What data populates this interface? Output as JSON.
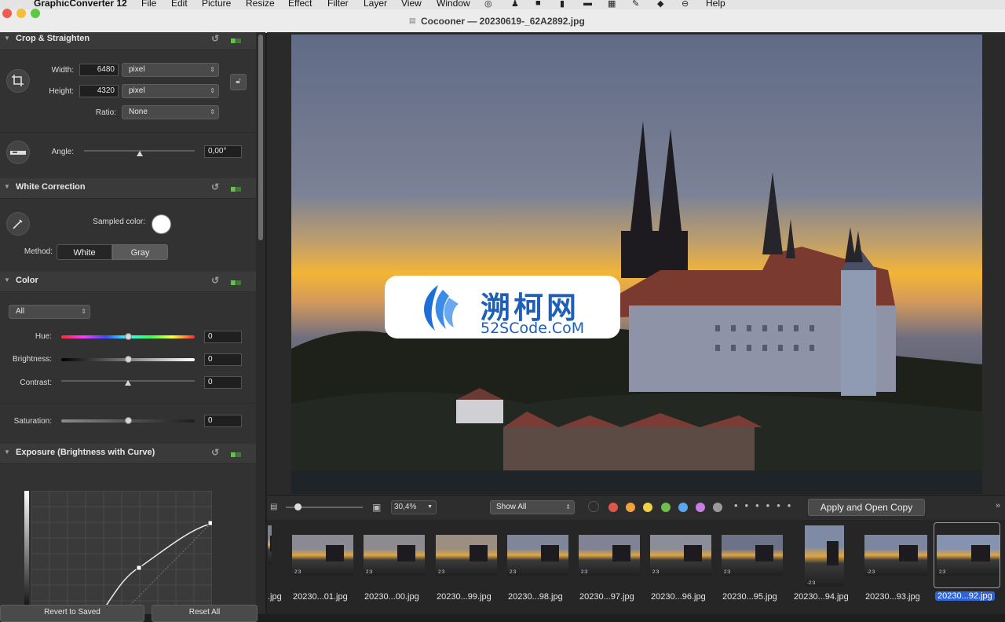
{
  "menubar": {
    "app_name": "GraphicConverter 12",
    "items": [
      "File",
      "Edit",
      "Picture",
      "Resize",
      "Effect",
      "Filter",
      "Layer",
      "View",
      "Window",
      "Help"
    ],
    "icons": [
      "target-icon",
      "person-icon",
      "camera-icon",
      "document-icon",
      "folder-icon",
      "grid-icon",
      "brush-icon",
      "tag-icon",
      "more-icon"
    ]
  },
  "window": {
    "title": "Cocooner — 20230619-_62A2892.jpg"
  },
  "crop": {
    "title": "Crop & Straighten",
    "width_label": "Width:",
    "width_value": "6480",
    "width_unit": "pixel",
    "height_label": "Height:",
    "height_value": "4320",
    "height_unit": "pixel",
    "ratio_label": "Ratio:",
    "ratio_value": "None",
    "angle_label": "Angle:",
    "angle_value": "0,00°"
  },
  "white": {
    "title": "White Correction",
    "sampled_label": "Sampled color:",
    "method_label": "Method:",
    "method_white": "White",
    "method_gray": "Gray"
  },
  "color": {
    "title": "Color",
    "channel": "All",
    "hue_label": "Hue:",
    "hue_value": "0",
    "brightness_label": "Brightness:",
    "brightness_value": "0",
    "contrast_label": "Contrast:",
    "contrast_value": "0",
    "saturation_label": "Saturation:",
    "saturation_value": "0"
  },
  "exposure": {
    "title": "Exposure (Brightness with Curve)"
  },
  "bottom": {
    "revert": "Revert to Saved",
    "reset_all": "Reset All"
  },
  "toolbar": {
    "zoom": "30,4%",
    "filter": "Show All",
    "apply_button": "Apply and Open Copy",
    "label_colors": [
      "#e0574a",
      "#f2a23c",
      "#f1d04a",
      "#6dc04f",
      "#5aa6f0",
      "#c47fe0",
      "#9a9a9a"
    ]
  },
  "watermark": {
    "title": "溯柯网",
    "subtitle": "52SCode.CoM"
  },
  "filmstrip": {
    "files": [
      ".jpg",
      "20230...01.jpg",
      "20230...00.jpg",
      "20230...99.jpg",
      "20230...98.jpg",
      "20230...97.jpg",
      "20230...96.jpg",
      "20230...95.jpg",
      "20230...94.jpg",
      "20230...93.jpg",
      "20230...92.jpg"
    ],
    "selected_index": 10,
    "badges": [
      "2:3",
      "2:3",
      "2:3",
      "2:3",
      "2:3",
      "2:3",
      "2:3",
      "-2:3",
      "-2:3",
      "2:3"
    ]
  }
}
